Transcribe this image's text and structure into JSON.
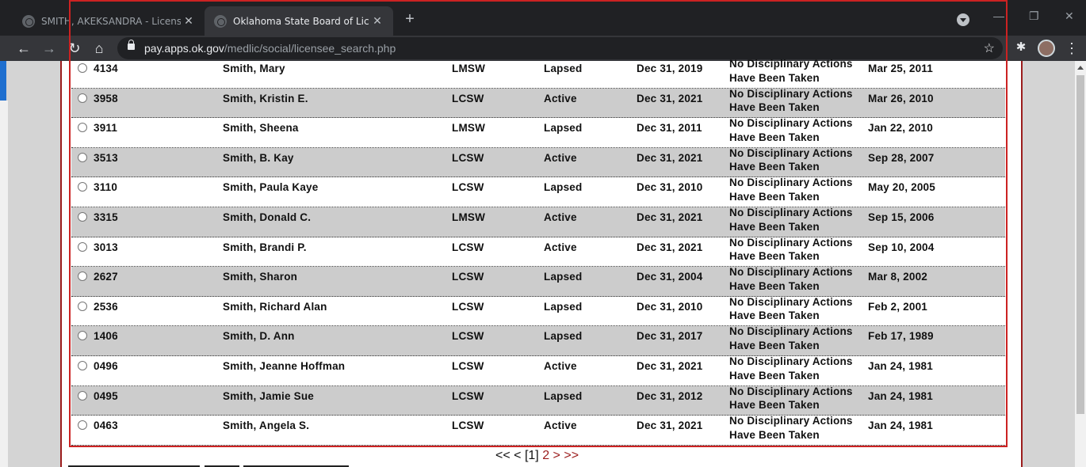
{
  "browser": {
    "tabs": [
      {
        "title": "SMITH, AKEKSANDRA - Licensee",
        "close": "✕"
      },
      {
        "title": "Oklahoma State Board of License",
        "close": "✕"
      }
    ],
    "new_tab": "+",
    "url_domain": "pay.apps.ok.gov",
    "url_path": "/medlic/social/licensee_search.php"
  },
  "rows": [
    {
      "number": "4134",
      "name": "Smith, Mary",
      "license_type": "LMSW",
      "status": "Lapsed",
      "expiration": "Dec 31, 2019",
      "discipline": "No Disciplinary Actions Have Been Taken",
      "issued": "Mar 25, 2011"
    },
    {
      "number": "3958",
      "name": "Smith, Kristin E.",
      "license_type": "LCSW",
      "status": "Active",
      "expiration": "Dec 31, 2021",
      "discipline": "No Disciplinary Actions Have Been Taken",
      "issued": "Mar 26, 2010"
    },
    {
      "number": "3911",
      "name": "Smith, Sheena",
      "license_type": "LMSW",
      "status": "Lapsed",
      "expiration": "Dec 31, 2011",
      "discipline": "No Disciplinary Actions Have Been Taken",
      "issued": "Jan 22, 2010"
    },
    {
      "number": "3513",
      "name": "Smith, B. Kay",
      "license_type": "LCSW",
      "status": "Active",
      "expiration": "Dec 31, 2021",
      "discipline": "No Disciplinary Actions Have Been Taken",
      "issued": "Sep 28, 2007"
    },
    {
      "number": "3110",
      "name": "Smith, Paula Kaye",
      "license_type": "LCSW",
      "status": "Lapsed",
      "expiration": "Dec 31, 2010",
      "discipline": "No Disciplinary Actions Have Been Taken",
      "issued": "May 20, 2005"
    },
    {
      "number": "3315",
      "name": "Smith, Donald C.",
      "license_type": "LMSW",
      "status": "Active",
      "expiration": "Dec 31, 2021",
      "discipline": "No Disciplinary Actions Have Been Taken",
      "issued": "Sep 15, 2006"
    },
    {
      "number": "3013",
      "name": "Smith, Brandi P.",
      "license_type": "LCSW",
      "status": "Active",
      "expiration": "Dec 31, 2021",
      "discipline": "No Disciplinary Actions Have Been Taken",
      "issued": "Sep 10, 2004"
    },
    {
      "number": "2627",
      "name": "Smith, Sharon",
      "license_type": "LCSW",
      "status": "Lapsed",
      "expiration": "Dec 31, 2004",
      "discipline": "No Disciplinary Actions Have Been Taken",
      "issued": "Mar 8, 2002"
    },
    {
      "number": "2536",
      "name": "Smith, Richard Alan",
      "license_type": "LCSW",
      "status": "Lapsed",
      "expiration": "Dec 31, 2010",
      "discipline": "No Disciplinary Actions Have Been Taken",
      "issued": "Feb 2, 2001"
    },
    {
      "number": "1406",
      "name": "Smith, D. Ann",
      "license_type": "LCSW",
      "status": "Lapsed",
      "expiration": "Dec 31, 2017",
      "discipline": "No Disciplinary Actions Have Been Taken",
      "issued": "Feb 17, 1989"
    },
    {
      "number": "0496",
      "name": "Smith, Jeanne Hoffman",
      "license_type": "LCSW",
      "status": "Active",
      "expiration": "Dec 31, 2021",
      "discipline": "No Disciplinary Actions Have Been Taken",
      "issued": "Jan 24, 1981"
    },
    {
      "number": "0495",
      "name": "Smith, Jamie Sue",
      "license_type": "LCSW",
      "status": "Lapsed",
      "expiration": "Dec 31, 2012",
      "discipline": "No Disciplinary Actions Have Been Taken",
      "issued": "Jan 24, 1981"
    },
    {
      "number": "0463",
      "name": "Smith, Angela S.",
      "license_type": "LCSW",
      "status": "Active",
      "expiration": "Dec 31, 2021",
      "discipline": "No Disciplinary Actions Have Been Taken",
      "issued": "Jan 24, 1981"
    }
  ],
  "pager": {
    "first": "<<",
    "prev": "<",
    "current": "[1]",
    "page2": "2",
    "next": ">",
    "last": ">>"
  }
}
